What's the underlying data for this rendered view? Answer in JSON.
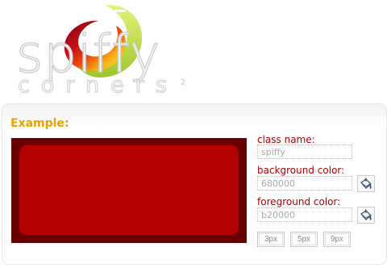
{
  "logo": {
    "word": "spiffy",
    "sub": "corners",
    "superscript": "2",
    "swirl_colors": [
      "#b10012",
      "#e23a0a",
      "#f59b14",
      "#f7d51c",
      "#b3d335"
    ]
  },
  "panel": {
    "title": "Example:",
    "demo": {
      "outer_color": "#680000",
      "inner_color": "#b20000"
    },
    "form": {
      "class_name": {
        "label": "class name:",
        "value": "spiffy"
      },
      "background_color": {
        "label": "background color:",
        "value": "680000",
        "picker_icon": "paint-bucket-icon"
      },
      "foreground_color": {
        "label": "foreground color:",
        "value": "b20000",
        "picker_icon": "paint-bucket-icon"
      },
      "radius_buttons": [
        "3px",
        "5px",
        "9px"
      ]
    }
  },
  "colors": {
    "title": "#e6a400",
    "labels": "#b00000"
  }
}
